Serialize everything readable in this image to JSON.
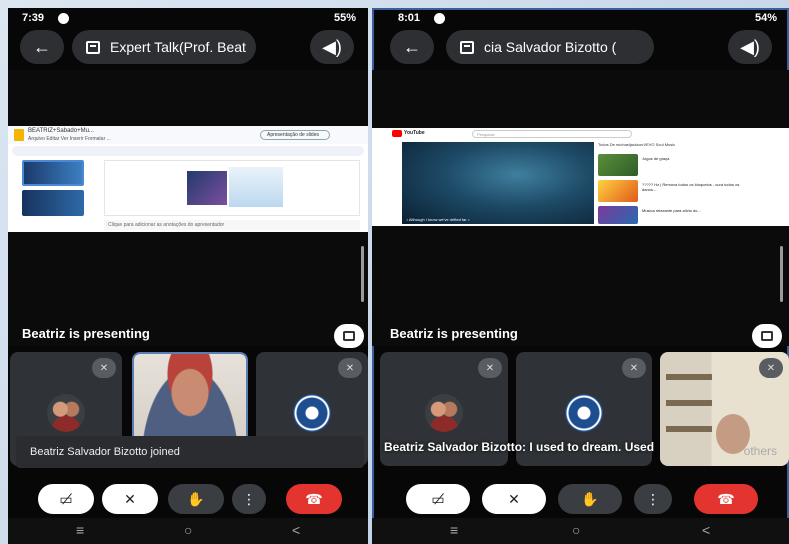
{
  "left": {
    "status": {
      "time": "7:39",
      "network": "55%"
    },
    "meeting_title": "Expert Talk(Prof. Beat",
    "slides": {
      "doc_title": "BEATRIZ+Sabado+Mu...",
      "menu": "Arquivo  Editar  Ver  Inserir  Formatar  ...",
      "present_label": "Apresentação de slides",
      "notes_placeholder": "Clique para adicionar as anotações do apresentador"
    },
    "presenting_label": "Beatriz is presenting",
    "toast": "Beatriz Salvador Bizotto joined"
  },
  "right": {
    "status": {
      "time": "8:01",
      "network": "54%"
    },
    "meeting_title": "cia Salvador Bizotto (",
    "youtube": {
      "brand": "YouTube",
      "search_placeholder": "Pesquisar",
      "chips": "Todos   De michaeljacksonVEVO   Soul Music",
      "player_caption": "♪ Although I know we've drifted far ♪",
      "rec1": "Jogos de graça",
      "rec2": "????? Hz | Remova todos os bloqueios - cura todos os danos...",
      "rec3": "Música relaxante para alívio do..."
    },
    "presenting_label": "Beatriz is presenting",
    "caption": "Beatriz Salvador Bizotto: I used to dream. Used",
    "others_label": "others"
  }
}
